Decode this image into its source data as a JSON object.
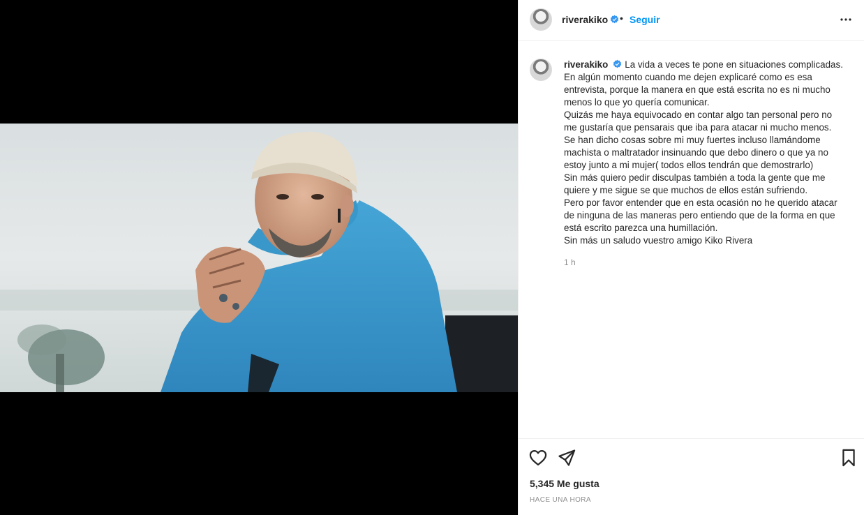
{
  "post": {
    "username": "riverakiko",
    "follow_label": "Seguir",
    "separator": "•",
    "more_icon": "more-horizontal-icon",
    "caption_lines": [
      "La vida a veces te pone en situaciones complicadas.",
      "En algún momento cuando me dejen explicaré como es esa",
      "entrevista, porque la manera en que está escrita no es ni mucho",
      "menos lo que yo quería comunicar.",
      "Quizás me haya equivocado en contar algo tan personal pero no",
      "me gustaría que pensarais que iba para atacar ni mucho menos.",
      "Se han dicho cosas sobre mi muy fuertes incluso llamándome",
      "machista o maltratador insinuando que debo dinero o que ya no",
      "estoy junto a mi mujer( todos ellos tendrán que demostrarlo)",
      "Sin más quiero pedir disculpas también a toda la gente que me",
      "quiere y me sigue se que muchos de ellos están sufriendo.",
      "Pero por favor entender que en esta ocasión no he querido atacar",
      "de ninguna de las maneras pero entiendo que de la forma en que",
      "está escrito parezca una humillación.",
      "Sin más un saludo vuestro amigo Kiko Rivera"
    ],
    "caption_time": "1 h",
    "likes": "5,345 Me gusta",
    "posted_ago": "HACE UNA HORA",
    "icons": {
      "like": "heart-icon",
      "share": "send-icon",
      "save": "bookmark-icon",
      "verified": "verified-badge-icon"
    },
    "colors": {
      "link": "#0095f6",
      "verified": "#3897f0",
      "secondary_text": "#8e8e8e"
    }
  }
}
